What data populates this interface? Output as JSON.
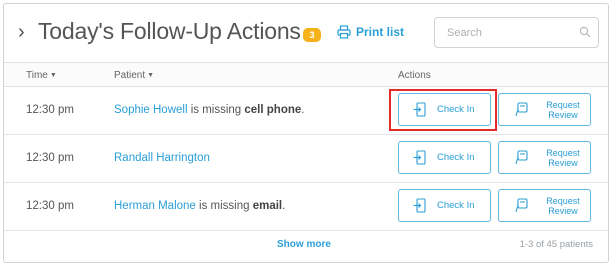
{
  "header": {
    "title": "Today's Follow-Up Actions",
    "badge": "3",
    "print_label": "Print list",
    "search_placeholder": "Search",
    "search_value": ""
  },
  "columns": {
    "time": "Time",
    "patient": "Patient",
    "actions": "Actions"
  },
  "rows": [
    {
      "time": "12:30 pm",
      "patient": "Sophie Howell",
      "middle_text": " is missing ",
      "missing": "cell phone",
      "end_text": ".",
      "checkin_label": "Check In",
      "review_label": "Request Review",
      "highlighted": true
    },
    {
      "time": "12:30 pm",
      "patient": "Randall Harrington",
      "middle_text": "",
      "missing": "",
      "end_text": "",
      "checkin_label": "Check In",
      "review_label": "Request Review",
      "highlighted": false
    },
    {
      "time": "12:30 pm",
      "patient": "Herman Malone",
      "middle_text": " is missing ",
      "missing": "email",
      "end_text": ".",
      "checkin_label": "Check In",
      "review_label": "Request Review",
      "highlighted": false
    }
  ],
  "footer": {
    "show_more": "Show more",
    "pager_info": "1-3 of 45 patients"
  },
  "colors": {
    "accent": "#2a9fd6",
    "badge": "#f5b21b",
    "highlight": "#e52a2a"
  }
}
